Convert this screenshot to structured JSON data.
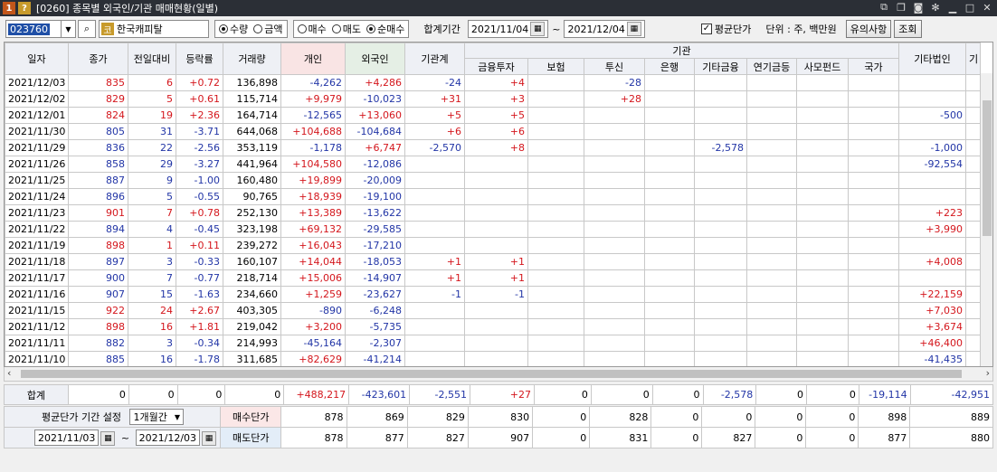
{
  "titlebar": {
    "badge1": "1",
    "badge2": "?",
    "title": "[0260] 종목별 외국인/기관 매매현황(일별)"
  },
  "toolbar": {
    "code": "023760",
    "name_badge": "코",
    "name": "한국캐피탈",
    "radio1": [
      {
        "label": "수량",
        "on": true
      },
      {
        "label": "금액",
        "on": false
      }
    ],
    "radio2": [
      {
        "label": "매수",
        "on": false
      },
      {
        "label": "매도",
        "on": false
      },
      {
        "label": "순매수",
        "on": true
      }
    ],
    "period_label": "합계기간",
    "date_from": "2021/11/04",
    "tilde": "~",
    "date_to": "2021/12/04",
    "avg_price_label": "평균단가",
    "unit_label": "단위 : 주, 백만원",
    "notice_btn": "유의사항",
    "query_btn": "조회"
  },
  "headers": {
    "date": "일자",
    "close": "종가",
    "change": "전일대비",
    "rate": "등락률",
    "volume": "거래량",
    "individual": "개인",
    "foreign": "외국인",
    "inst_total": "기관계",
    "inst_group": "기관",
    "fin": "금융투자",
    "ins": "보험",
    "trust": "투신",
    "bank": "은행",
    "otherfin": "기타금융",
    "pension": "연기금등",
    "private": "사모펀드",
    "nation": "국가",
    "othercorp": "기타법인",
    "more": "기"
  },
  "rows": [
    {
      "d": "2021/12/03",
      "c": "835",
      "cc": "r",
      "ch": "6",
      "r": "+0.72",
      "v": "136,898",
      "ind": "-4,262",
      "fgn": "+4,286",
      "it": "-24",
      "fin": "+4",
      "ins": "",
      "tr": "-28",
      "bk": "",
      "of": "",
      "pn": "",
      "pv": "",
      "na": "",
      "oc": ""
    },
    {
      "d": "2021/12/02",
      "c": "829",
      "cc": "r",
      "ch": "5",
      "r": "+0.61",
      "v": "115,714",
      "ind": "+9,979",
      "fgn": "-10,023",
      "it": "+31",
      "fin": "+3",
      "ins": "",
      "tr": "+28",
      "bk": "",
      "of": "",
      "pn": "",
      "pv": "",
      "na": "",
      "oc": ""
    },
    {
      "d": "2021/12/01",
      "c": "824",
      "cc": "r",
      "ch": "19",
      "r": "+2.36",
      "v": "164,714",
      "ind": "-12,565",
      "fgn": "+13,060",
      "it": "+5",
      "fin": "+5",
      "ins": "",
      "tr": "",
      "bk": "",
      "of": "",
      "pn": "",
      "pv": "",
      "na": "",
      "oc": "-500"
    },
    {
      "d": "2021/11/30",
      "c": "805",
      "cc": "b",
      "ch": "31",
      "r": "-3.71",
      "v": "644,068",
      "ind": "+104,688",
      "fgn": "-104,684",
      "it": "+6",
      "fin": "+6",
      "ins": "",
      "tr": "",
      "bk": "",
      "of": "",
      "pn": "",
      "pv": "",
      "na": "",
      "oc": ""
    },
    {
      "d": "2021/11/29",
      "c": "836",
      "cc": "b",
      "ch": "22",
      "r": "-2.56",
      "v": "353,119",
      "ind": "-1,178",
      "fgn": "+6,747",
      "it": "-2,570",
      "fin": "+8",
      "ins": "",
      "tr": "",
      "bk": "",
      "of": "-2,578",
      "pn": "",
      "pv": "",
      "na": "",
      "oc": "-1,000"
    },
    {
      "d": "2021/11/26",
      "c": "858",
      "cc": "b",
      "ch": "29",
      "r": "-3.27",
      "v": "441,964",
      "ind": "+104,580",
      "fgn": "-12,086",
      "it": "",
      "fin": "",
      "ins": "",
      "tr": "",
      "bk": "",
      "of": "",
      "pn": "",
      "pv": "",
      "na": "",
      "oc": "-92,554"
    },
    {
      "d": "2021/11/25",
      "c": "887",
      "cc": "b",
      "ch": "9",
      "r": "-1.00",
      "v": "160,480",
      "ind": "+19,899",
      "fgn": "-20,009",
      "it": "",
      "fin": "",
      "ins": "",
      "tr": "",
      "bk": "",
      "of": "",
      "pn": "",
      "pv": "",
      "na": "",
      "oc": ""
    },
    {
      "d": "2021/11/24",
      "c": "896",
      "cc": "b",
      "ch": "5",
      "r": "-0.55",
      "v": "90,765",
      "ind": "+18,939",
      "fgn": "-19,100",
      "it": "",
      "fin": "",
      "ins": "",
      "tr": "",
      "bk": "",
      "of": "",
      "pn": "",
      "pv": "",
      "na": "",
      "oc": ""
    },
    {
      "d": "2021/11/23",
      "c": "901",
      "cc": "r",
      "ch": "7",
      "r": "+0.78",
      "v": "252,130",
      "ind": "+13,389",
      "fgn": "-13,622",
      "it": "",
      "fin": "",
      "ins": "",
      "tr": "",
      "bk": "",
      "of": "",
      "pn": "",
      "pv": "",
      "na": "",
      "oc": "+223"
    },
    {
      "d": "2021/11/22",
      "c": "894",
      "cc": "b",
      "ch": "4",
      "r": "-0.45",
      "v": "323,198",
      "ind": "+69,132",
      "fgn": "-29,585",
      "it": "",
      "fin": "",
      "ins": "",
      "tr": "",
      "bk": "",
      "of": "",
      "pn": "",
      "pv": "",
      "na": "",
      "oc": "+3,990"
    },
    {
      "d": "2021/11/19",
      "c": "898",
      "cc": "r",
      "ch": "1",
      "r": "+0.11",
      "v": "239,272",
      "ind": "+16,043",
      "fgn": "-17,210",
      "it": "",
      "fin": "",
      "ins": "",
      "tr": "",
      "bk": "",
      "of": "",
      "pn": "",
      "pv": "",
      "na": "",
      "oc": ""
    },
    {
      "d": "2021/11/18",
      "c": "897",
      "cc": "b",
      "ch": "3",
      "r": "-0.33",
      "v": "160,107",
      "ind": "+14,044",
      "fgn": "-18,053",
      "it": "+1",
      "fin": "+1",
      "ins": "",
      "tr": "",
      "bk": "",
      "of": "",
      "pn": "",
      "pv": "",
      "na": "",
      "oc": "+4,008"
    },
    {
      "d": "2021/11/17",
      "c": "900",
      "cc": "b",
      "ch": "7",
      "r": "-0.77",
      "v": "218,714",
      "ind": "+15,006",
      "fgn": "-14,907",
      "it": "+1",
      "fin": "+1",
      "ins": "",
      "tr": "",
      "bk": "",
      "of": "",
      "pn": "",
      "pv": "",
      "na": "",
      "oc": ""
    },
    {
      "d": "2021/11/16",
      "c": "907",
      "cc": "b",
      "ch": "15",
      "r": "-1.63",
      "v": "234,660",
      "ind": "+1,259",
      "fgn": "-23,627",
      "it": "-1",
      "fin": "-1",
      "ins": "",
      "tr": "",
      "bk": "",
      "of": "",
      "pn": "",
      "pv": "",
      "na": "",
      "oc": "+22,159"
    },
    {
      "d": "2021/11/15",
      "c": "922",
      "cc": "r",
      "ch": "24",
      "r": "+2.67",
      "v": "403,305",
      "ind": "-890",
      "fgn": "-6,248",
      "it": "",
      "fin": "",
      "ins": "",
      "tr": "",
      "bk": "",
      "of": "",
      "pn": "",
      "pv": "",
      "na": "",
      "oc": "+7,030"
    },
    {
      "d": "2021/11/12",
      "c": "898",
      "cc": "r",
      "ch": "16",
      "r": "+1.81",
      "v": "219,042",
      "ind": "+3,200",
      "fgn": "-5,735",
      "it": "",
      "fin": "",
      "ins": "",
      "tr": "",
      "bk": "",
      "of": "",
      "pn": "",
      "pv": "",
      "na": "",
      "oc": "+3,674"
    },
    {
      "d": "2021/11/11",
      "c": "882",
      "cc": "b",
      "ch": "3",
      "r": "-0.34",
      "v": "214,993",
      "ind": "-45,164",
      "fgn": "-2,307",
      "it": "",
      "fin": "",
      "ins": "",
      "tr": "",
      "bk": "",
      "of": "",
      "pn": "",
      "pv": "",
      "na": "",
      "oc": "+46,400"
    },
    {
      "d": "2021/11/10",
      "c": "885",
      "cc": "b",
      "ch": "16",
      "r": "-1.78",
      "v": "311,685",
      "ind": "+82,629",
      "fgn": "-41,214",
      "it": "",
      "fin": "",
      "ins": "",
      "tr": "",
      "bk": "",
      "of": "",
      "pn": "",
      "pv": "",
      "na": "",
      "oc": "-41,435"
    }
  ],
  "summary": {
    "label": "합계",
    "close": "0",
    "change": "0",
    "rate": "0",
    "volume": "0",
    "ind": "+488,217",
    "fgn": "-423,601",
    "it": "-2,551",
    "fin": "+27",
    "ins": "0",
    "tr": "0",
    "bk": "0",
    "of": "-2,578",
    "pn": "0",
    "pv": "0",
    "na": "-19,114",
    "oc": "-42,951"
  },
  "avg": {
    "period_label": "평균단가 기간 설정",
    "period_value": "1개월간",
    "buy_label": "매수단가",
    "sell_label": "매도단가",
    "date_from": "2021/11/03",
    "tilde": "~",
    "date_to": "2021/12/03",
    "buy": {
      "ind": "878",
      "fgn": "869",
      "it": "829",
      "fin": "830",
      "ins": "0",
      "tr": "828",
      "bk": "0",
      "of": "0",
      "pn": "0",
      "pv": "0",
      "na": "898",
      "oc": "889"
    },
    "sell": {
      "ind": "878",
      "fgn": "877",
      "it": "827",
      "fin": "907",
      "ins": "0",
      "tr": "831",
      "bk": "0",
      "of": "827",
      "pn": "0",
      "pv": "0",
      "na": "877",
      "oc": "880"
    }
  },
  "colors": {
    "up": "#d4161c",
    "down": "#2235a6",
    "titlebar": "#2b2f36"
  }
}
